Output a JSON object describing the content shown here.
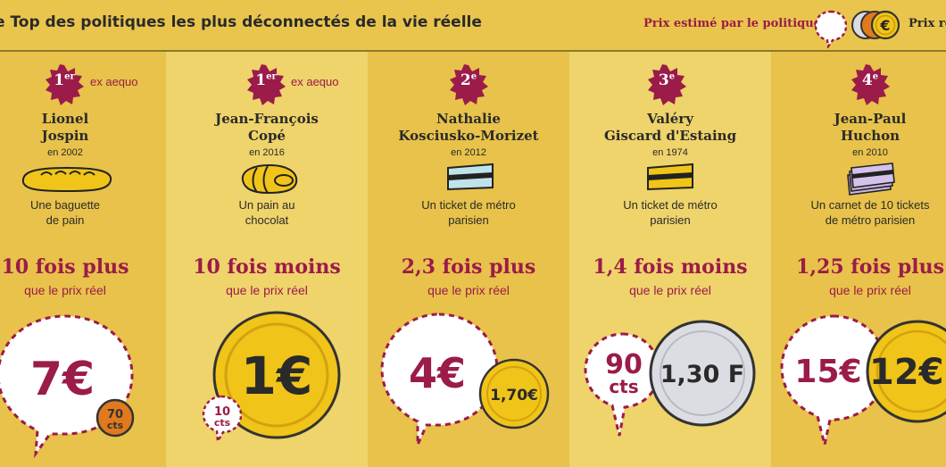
{
  "header": {
    "title": "e Top des politiques les plus déconnectés de la vie réelle",
    "legend_estimated": "Prix estimé par le politique",
    "legend_real": "Prix ré",
    "legend_coin_symbol": "€"
  },
  "colors": {
    "wine": "#9b1b4a",
    "gold": "#f0c419",
    "gold_dark": "#d4a10f",
    "silver": "#dcdde3",
    "bronze": "#e07a1c"
  },
  "columns": [
    {
      "rank": "1",
      "rank_sup": "er",
      "aequo": "ex aequo",
      "name_line1": "Lionel",
      "name_line2": "Jospin",
      "year": "en 2002",
      "object_icon": "baguette-icon",
      "object_line1": "Une baguette",
      "object_line2": "de pain",
      "ratio": "10 fois plus",
      "ratio_sub": "que le prix réel",
      "estimate": "7€",
      "real": "70",
      "real_unit": "cts"
    },
    {
      "rank": "1",
      "rank_sup": "er",
      "aequo": "ex aequo",
      "name_line1": "Jean-François",
      "name_line2": "Copé",
      "year": "en 2016",
      "object_icon": "pain-au-chocolat-icon",
      "object_line1": "Un pain au",
      "object_line2": "chocolat",
      "ratio": "10 fois moins",
      "ratio_sub": "que le prix réel",
      "estimate": "10",
      "estimate_unit": "cts",
      "real": "1€"
    },
    {
      "rank": "2",
      "rank_sup": "e",
      "name_line1": "Nathalie",
      "name_line2": "Kosciusko-Morizet",
      "year": "en 2012",
      "object_icon": "metro-ticket-icon",
      "object_line1": "Un ticket de métro",
      "object_line2": "parisien",
      "ratio": "2,3 fois plus",
      "ratio_sub": "que le prix réel",
      "estimate": "4€",
      "real": "1,70€"
    },
    {
      "rank": "3",
      "rank_sup": "e",
      "name_line1": "Valéry",
      "name_line2": "Giscard d'Estaing",
      "year": "en 1974",
      "object_icon": "metro-ticket-icon",
      "object_line1": "Un ticket de métro",
      "object_line2": "parisien",
      "ratio": "1,4 fois moins",
      "ratio_sub": "que le prix réel",
      "estimate": "90",
      "estimate_unit": "cts",
      "real": "1,30 F"
    },
    {
      "rank": "4",
      "rank_sup": "e",
      "name_line1": "Jean-Paul",
      "name_line2": "Huchon",
      "year": "en 2010",
      "object_icon": "metro-carnet-icon",
      "object_line1": "Un carnet de 10 tickets",
      "object_line2": "de métro parisien",
      "ratio": "1,25 fois plus",
      "ratio_sub": "que le prix réel",
      "estimate": "15€",
      "real": "12€"
    }
  ]
}
